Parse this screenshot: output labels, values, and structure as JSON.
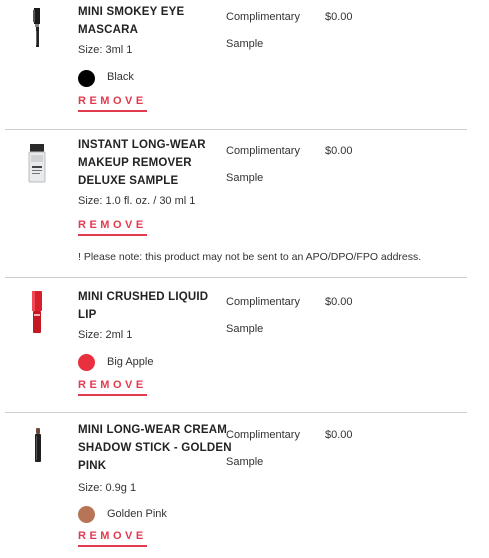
{
  "items": [
    {
      "name": "MINI SMOKEY EYE MASCARA",
      "size": "Size: 3ml 1",
      "sample_line1": "Complimentary",
      "sample_line2": "Sample",
      "price": "$0.00",
      "shade": "Black",
      "shade_color": "#000000",
      "remove_label": "REMOVE",
      "icon": "mascara-icon"
    },
    {
      "name": "INSTANT LONG-WEAR MAKEUP REMOVER DELUXE SAMPLE",
      "size": "Size: 1.0 fl. oz. / 30 ml 1",
      "sample_line1": "Complimentary",
      "sample_line2": "Sample",
      "price": "$0.00",
      "remove_label": "REMOVE",
      "note": "! Please note: this product may not be sent to an APO/DPO/FPO address.",
      "icon": "remover-bottle-icon"
    },
    {
      "name": "MINI CRUSHED LIQUID LIP",
      "size": "Size: 2ml 1",
      "sample_line1": "Complimentary",
      "sample_line2": "Sample",
      "price": "$0.00",
      "shade": "Big Apple",
      "shade_color": "#e8303f",
      "remove_label": "REMOVE",
      "icon": "liquid-lip-icon"
    },
    {
      "name": "MINI LONG-WEAR CREAM SHADOW STICK - GOLDEN PINK",
      "size": "Size: 0.9g 1",
      "sample_line1": "Complimentary",
      "sample_line2": "Sample",
      "price": "$0.00",
      "shade": "Golden Pink",
      "shade_color": "#b87457",
      "remove_label": "REMOVE",
      "icon": "shadow-stick-icon"
    }
  ],
  "colors": {
    "accent": "#e23a4e",
    "divider": "#cfcfcf"
  }
}
